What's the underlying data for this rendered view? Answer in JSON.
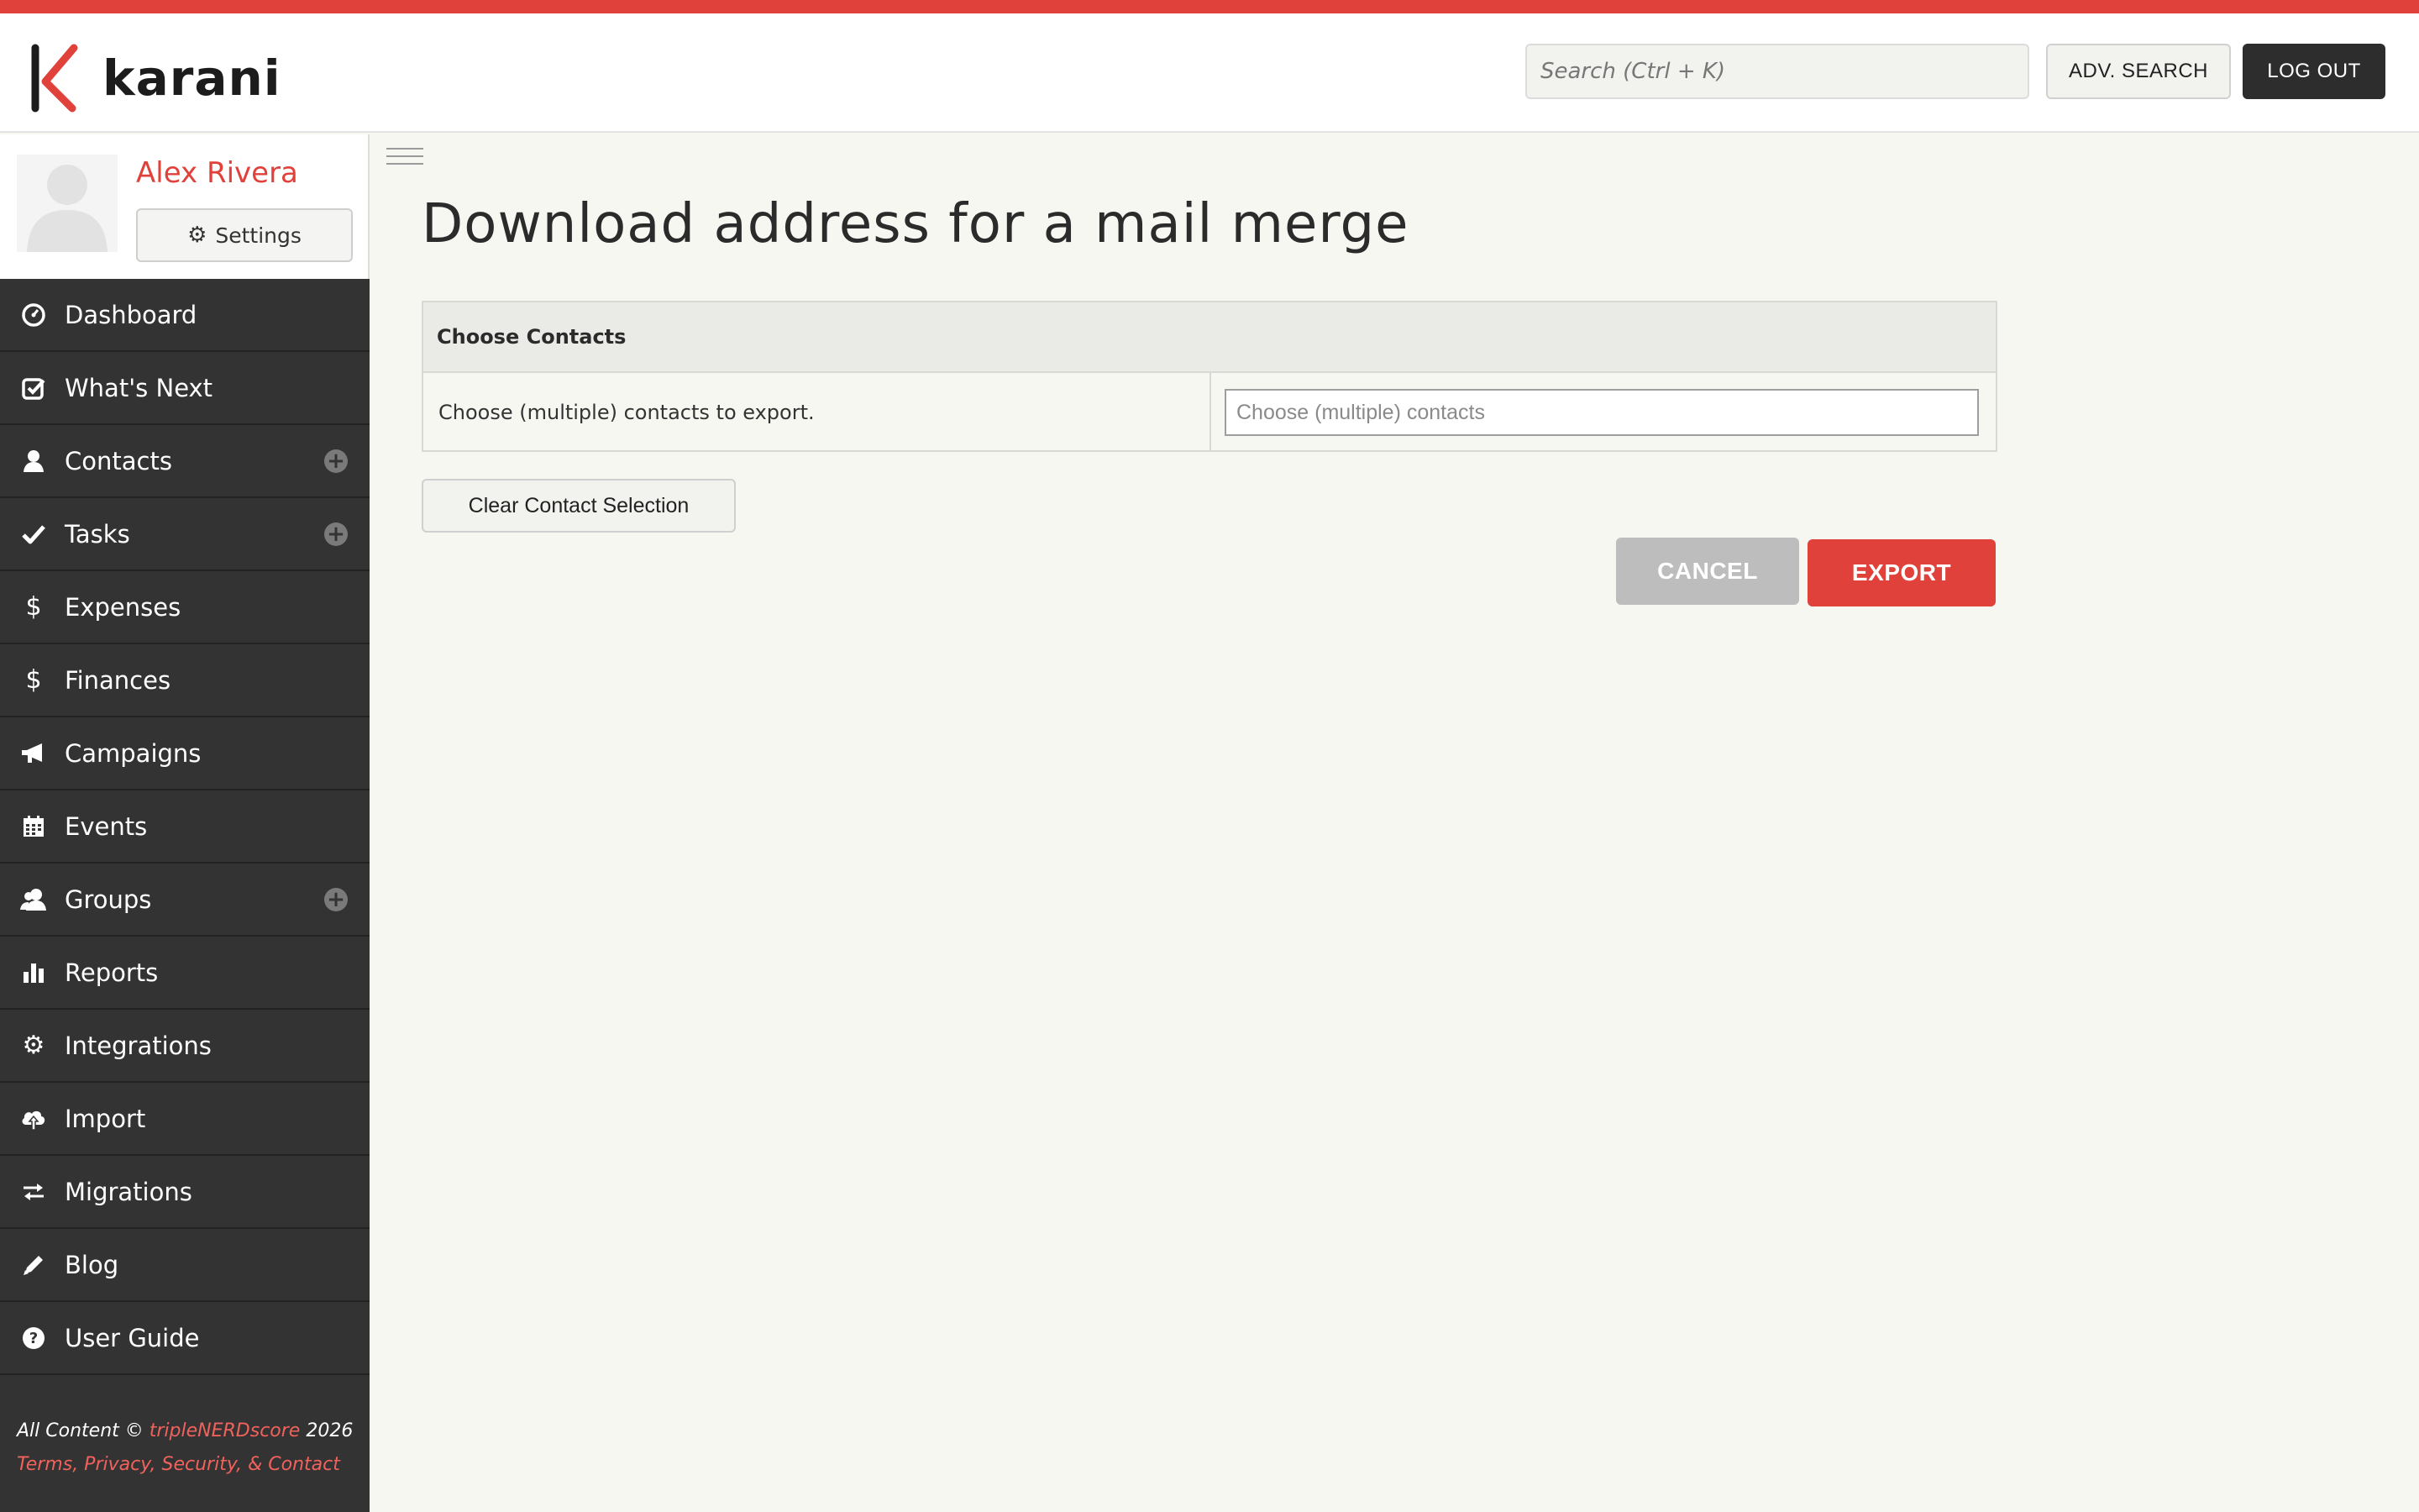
{
  "brand": {
    "name": "karani",
    "accent": "#e0413a",
    "logo_icon": "karani-k-logo"
  },
  "header": {
    "search_placeholder": "Search (Ctrl + K)",
    "search_value": "",
    "adv_search_label": "ADV. SEARCH",
    "logout_label": "LOG OUT"
  },
  "profile": {
    "name": "Alex Rivera",
    "avatar_icon": "user-silhouette-icon",
    "settings_label": "Settings",
    "settings_icon": "gear-icon"
  },
  "sidebar": {
    "items": [
      {
        "label": "Dashboard",
        "icon": "dashboard-icon",
        "has_add": false
      },
      {
        "label": "What's Next",
        "icon": "check-square-icon",
        "has_add": false
      },
      {
        "label": "Contacts",
        "icon": "user-icon",
        "has_add": true
      },
      {
        "label": "Tasks",
        "icon": "check-icon",
        "has_add": true
      },
      {
        "label": "Expenses",
        "icon": "dollar-icon",
        "has_add": false
      },
      {
        "label": "Finances",
        "icon": "dollar-icon",
        "has_add": false
      },
      {
        "label": "Campaigns",
        "icon": "megaphone-icon",
        "has_add": false
      },
      {
        "label": "Events",
        "icon": "calendar-icon",
        "has_add": false
      },
      {
        "label": "Groups",
        "icon": "users-icon",
        "has_add": true
      },
      {
        "label": "Reports",
        "icon": "bar-chart-icon",
        "has_add": false
      },
      {
        "label": "Integrations",
        "icon": "gear-icon",
        "has_add": false
      },
      {
        "label": "Import",
        "icon": "cloud-upload-icon",
        "has_add": false
      },
      {
        "label": "Migrations",
        "icon": "arrows-exchange-icon",
        "has_add": false
      },
      {
        "label": "Blog",
        "icon": "pencil-icon",
        "has_add": false
      },
      {
        "label": "User Guide",
        "icon": "question-circle-icon",
        "has_add": false
      }
    ]
  },
  "footer": {
    "prefix": "All Content ©",
    "company": "tripleNERDscore",
    "year": "2026",
    "links": "Terms, Privacy, Security, & Contact"
  },
  "main": {
    "title": "Download address for a mail merge",
    "panel": {
      "header": "Choose Contacts",
      "label": "Choose (multiple) contacts to export.",
      "input_placeholder": "Choose (multiple) contacts",
      "input_value": ""
    },
    "clear_label": "Clear Contact Selection",
    "cancel_label": "CANCEL",
    "export_label": "EXPORT"
  }
}
